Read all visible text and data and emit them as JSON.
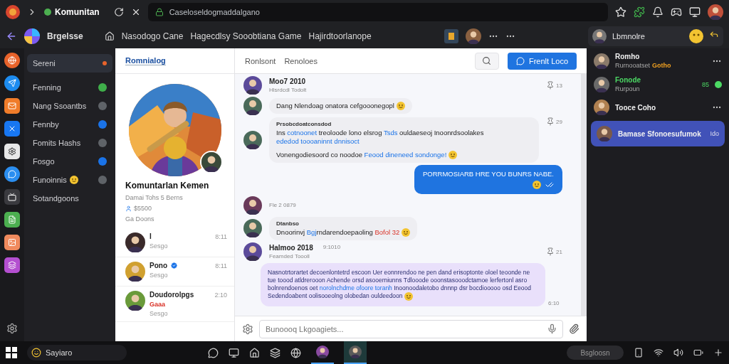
{
  "browser": {
    "tab_title": "Komunitan",
    "url": "Caseloseldogmaddalgano"
  },
  "app": {
    "title": "Brgelsse",
    "nav": [
      "Nasodogo Cane",
      "Hagecdlsy Sooobtiana Game",
      "Hajirdtoorlanope"
    ],
    "user": "Lbmnolre"
  },
  "rail": [
    {
      "color": "#e8632b"
    },
    {
      "color": "#1d8cf0"
    },
    {
      "color": "#f07c2a"
    },
    {
      "color": "#1877f2"
    },
    {
      "color": "#e8e8e8"
    },
    {
      "color": "#2b8ef0"
    },
    {
      "color": "#3a3a3f"
    },
    {
      "color": "#4caf50"
    },
    {
      "color": "#f08a5d"
    },
    {
      "color": "#b44fd0"
    }
  ],
  "sidebar": {
    "items": [
      {
        "label": "Sereni",
        "selected": true,
        "color": "#e8632b"
      },
      {
        "label": "Fenning",
        "selected": false,
        "color": "#3fae4a"
      },
      {
        "label": "Nang Ssoantbs",
        "selected": false,
        "color": "#5f6368"
      },
      {
        "label": "Fennby",
        "selected": false,
        "color": "#1a73e8"
      },
      {
        "label": "Fomits Hashs",
        "selected": false,
        "color": "#5f6368"
      },
      {
        "label": "Fosgo",
        "selected": false,
        "color": "#1a73e8"
      },
      {
        "label": "Funoinnis",
        "selected": false,
        "color": "#5f6368",
        "has_emoji": true
      },
      {
        "label": "Sotandgoons",
        "selected": false
      }
    ]
  },
  "profile": {
    "tab": "Romnialog",
    "name": "Komuntarlan Kemen",
    "subtitle": "Damai Tohs 5 Berns",
    "stat": "$5500",
    "note": "Ga Doons",
    "contacts": [
      {
        "name": "I",
        "time": "8:11",
        "status": "Sesgo",
        "verified": false
      },
      {
        "name": "Pono",
        "time": "8:11",
        "status": "Sesgo",
        "verified": true
      },
      {
        "name": "Doudorolpgs",
        "time": "2:10",
        "status": "Sesgo",
        "verified": false,
        "tag": "Gaaa"
      }
    ]
  },
  "chat": {
    "tabs": [
      "Ronlsont",
      "Renoloes"
    ],
    "action": "Frenlt Loco",
    "messages": [
      {
        "kind": "header",
        "name": "Moo7 2010",
        "subtitle": "Hlsrdcdl Todolt",
        "reaction": "13"
      },
      {
        "kind": "bubble",
        "paragraphs": [
          [
            {
              "kind": "text",
              "text": "Dang Nlendoag onatora cefgooonegopl"
            }
          ]
        ],
        "has_emoji": true
      },
      {
        "kind": "bubble",
        "author": "Prsobcdoatconsdod",
        "reaction": "29",
        "paragraphs": [
          [
            {
              "kind": "text",
              "text": "Ins "
            },
            {
              "kind": "link",
              "text": "cotnoonet"
            },
            {
              "kind": "text",
              "text": " treoloode lono elsrog "
            },
            {
              "kind": "link",
              "text": "Tsds"
            },
            {
              "kind": "text",
              "text": " ouldaeseoj Inoonrdsoolakes "
            },
            {
              "kind": "link",
              "text": "ededod toooaninnt dnnisoct"
            }
          ],
          [
            {
              "kind": "text",
              "text": "Vonengodiesoord co noodoe "
            },
            {
              "kind": "link",
              "text": "Feood dineneed sondonge!"
            }
          ]
        ],
        "has_emoji": true
      },
      {
        "kind": "outgoing",
        "paragraphs": [
          [
            {
              "kind": "text",
              "text": "PORRMOSIARB HRE YOU BUNRS NABE."
            }
          ]
        ],
        "read": true
      },
      {
        "kind": "timestamp",
        "text": "Fle 2 0879"
      },
      {
        "kind": "bubble",
        "author": "Dtanbso",
        "paragraphs": [
          [
            {
              "kind": "text",
              "text": "Dnoorinvj "
            },
            {
              "kind": "link",
              "text": "Bgj"
            },
            {
              "kind": "text",
              "text": "rndarendoepaoling "
            },
            {
              "kind": "highlight",
              "text": "Bofol 32"
            }
          ]
        ],
        "has_emoji": true
      },
      {
        "kind": "header",
        "name": "Halmoo 2018",
        "time": "9:1010",
        "subtitle": "Feamded Toooll",
        "reaction": "21"
      },
      {
        "kind": "long",
        "time": "6:10",
        "paragraphs": [
          [
            {
              "kind": "text",
              "text": "Nasnotrtorartet decoenlontetrd escoon Uer eonnrendoo ne pen dand erisoptonte oloel teoonde ne tue toood atldrerooon Achende orsd asooerniunns Tdlooode ooonstasooodctamoe lerfertonl asro bolnrendoenos oet "
            },
            {
              "kind": "link",
              "text": "norolnchdme ofoore toranh"
            },
            {
              "kind": "text",
              "text": " Inoonoodaletobo dnnnp dsr bocdiooooo osd Eeood Sedendoabent oolisooeolng olobedan ouldeedoon"
            }
          ]
        ],
        "has_emoji": true
      }
    ],
    "input": {
      "placeholder": "Bunoooq Lkgoagiets..."
    }
  },
  "right_panel": {
    "items": [
      {
        "name": "Romho",
        "subtitle": "Rurnooatset",
        "tag": "Gotho",
        "selected": false
      },
      {
        "name": "Fonode",
        "subtitle": "Rurpoun",
        "count": "85",
        "online": true,
        "selected": false
      },
      {
        "name": "Tooce Coho",
        "selected": false
      },
      {
        "name": "Bamase Sfonoesufumok",
        "time": "Ido",
        "selected": true
      }
    ]
  },
  "taskbar": {
    "search": "Sayiaro",
    "tray": "Bsgloosn"
  }
}
